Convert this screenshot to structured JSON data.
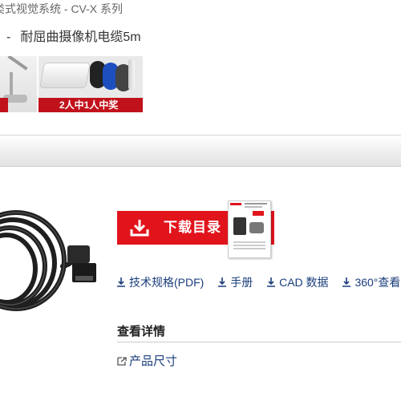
{
  "header": {
    "breadcrumb": "类式视觉系统 - CV-X 系列",
    "product_title_prefix": "-",
    "product_title": "耐屈曲摄像机电缆5m"
  },
  "promo_banner": {
    "caption": "2人中1人中奖",
    "accent_color": "#c1121b"
  },
  "download": {
    "label": "下载目录",
    "icon": "download-tray-icon",
    "color": "#e1141c"
  },
  "catalog_thumbnail": {
    "icon": "catalog-cover-image"
  },
  "doc_links": [
    {
      "label": "技术规格(PDF)",
      "icon": "download-arrow-icon"
    },
    {
      "label": "手册",
      "icon": "download-arrow-icon"
    },
    {
      "label": "CAD 数据",
      "icon": "download-arrow-icon"
    },
    {
      "label": "360°查看",
      "icon": "download-arrow-icon"
    }
  ],
  "details": {
    "heading": "查看详情",
    "items": [
      {
        "label": "产品尺寸",
        "icon": "external-arrow-icon"
      }
    ]
  },
  "colors": {
    "link": "#1a3d7c",
    "text": "#333333"
  }
}
